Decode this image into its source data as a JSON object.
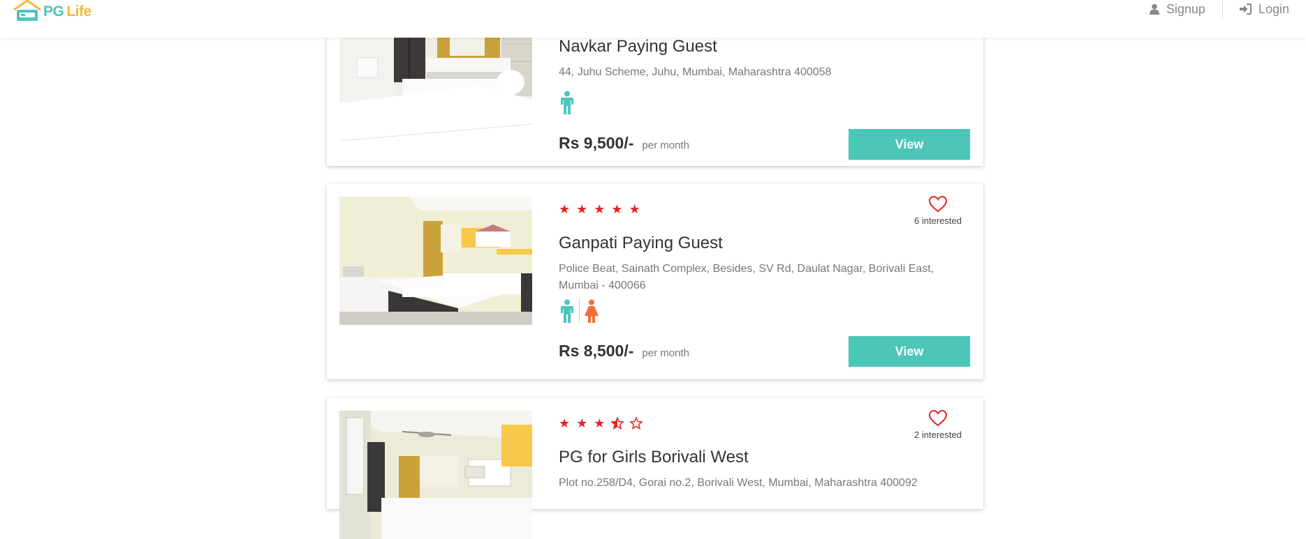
{
  "header": {
    "logo_pg": "PG",
    "logo_life": "Life",
    "signup_label": "Signup",
    "login_label": "Login",
    "accent": "#4bc6b9",
    "logo_secondary": "#f5b73b"
  },
  "properties": [
    {
      "name": "Navkar Paying Guest",
      "address": "44, Juhu Scheme, Juhu, Mumbai, Maharashtra 400058",
      "gender_icons": [
        "male-icon"
      ],
      "rent": "Rs 9,500/-",
      "rent_unit": "per month",
      "view_label": "View"
    },
    {
      "rating": 5,
      "stars": "★★★★★",
      "interested": "6 interested",
      "name": "Ganpati Paying Guest",
      "address": "Police Beat, Sainath Complex, Besides, SV Rd, Daulat Nagar, Borivali East, Mumbai - 400066",
      "gender_icons": [
        "male-icon",
        "female-icon"
      ],
      "rent": "Rs 8,500/-",
      "rent_unit": "per month",
      "view_label": "View"
    },
    {
      "rating": 3.5,
      "interested": "2 interested",
      "name": "PG for Girls Borivali West",
      "address": "Plot no.258/D4, Gorai no.2, Borivali West, Mumbai, Maharashtra 400092"
    }
  ],
  "colors": {
    "star": "#e62222",
    "male": "#4bc6b9",
    "female": "#f0703a",
    "heart": "#e62222"
  }
}
